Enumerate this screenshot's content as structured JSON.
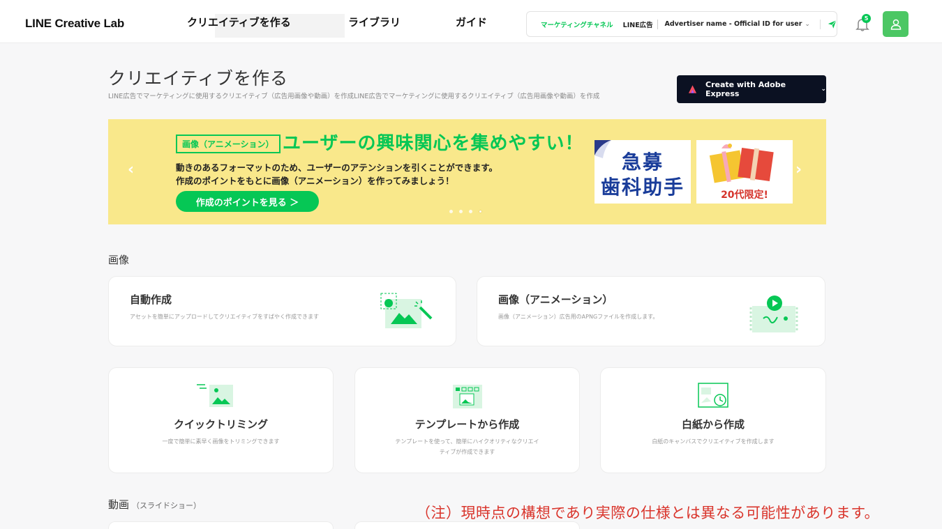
{
  "header": {
    "logo": "LINE Creative Lab",
    "nav": [
      "クリエイティブを作る",
      "ライブラリ",
      "ガイド"
    ],
    "channel_label": "マーケティングチャネル",
    "channel_value": "LINE広告",
    "account_label": "Advertiser name - Official ID for user",
    "notification_count": "5",
    "accent_color": "#06c755"
  },
  "page": {
    "title": "クリエイティブを作る",
    "subtitle": "LINE広告でマーケティングに使用するクリエイティブ（広告用画像や動画）を作成LINE広告でマーケティングに使用するクリエイティブ（広告用画像や動画）を作成",
    "adobe_button": "Create with Adobe Express"
  },
  "banner": {
    "tag": "画像（アニメーション）",
    "headline": "ユーザーの興味関心を集めやすい！",
    "desc_line1": "動きのあるフォーマットのため、ユーザーのアテンションを引くことができます。",
    "desc_line2": "作成のポイントをもとに画像（アニメーション）を作ってみましょう！",
    "cta": "作成のポイントを見る ＞",
    "thumb1_line1": "急募",
    "thumb1_line2": "歯科助手",
    "thumb2_text": "20代限定!",
    "slides_total": 4,
    "active_slide": 4
  },
  "sections": {
    "image": "画像",
    "video": "動画",
    "video_sub": "（スライドショー）"
  },
  "cards": {
    "auto": {
      "title": "自動作成",
      "desc": "アセットを簡単にアップロードしてクリエイティブをすばやく作成できます"
    },
    "anim": {
      "title": "画像（アニメーション）",
      "desc": "画像（アニメーション）広告用のAPNGファイルを作成します。"
    },
    "trim": {
      "title": "クイックトリミング",
      "desc": "一度で簡単に素早く画像をトリミングできます"
    },
    "tmpl": {
      "title": "テンプレートから作成",
      "desc1": "テンプレートを使って、簡単にハイクオリティなクリエイ",
      "desc2": "ティブが作成できます"
    },
    "blank": {
      "title": "白紙から作成",
      "desc": "白紙のキャンバスでクリエイティブを作成します"
    }
  },
  "note": "（注）現時点の構想であり実際の仕様とは異なる可能性があります。"
}
